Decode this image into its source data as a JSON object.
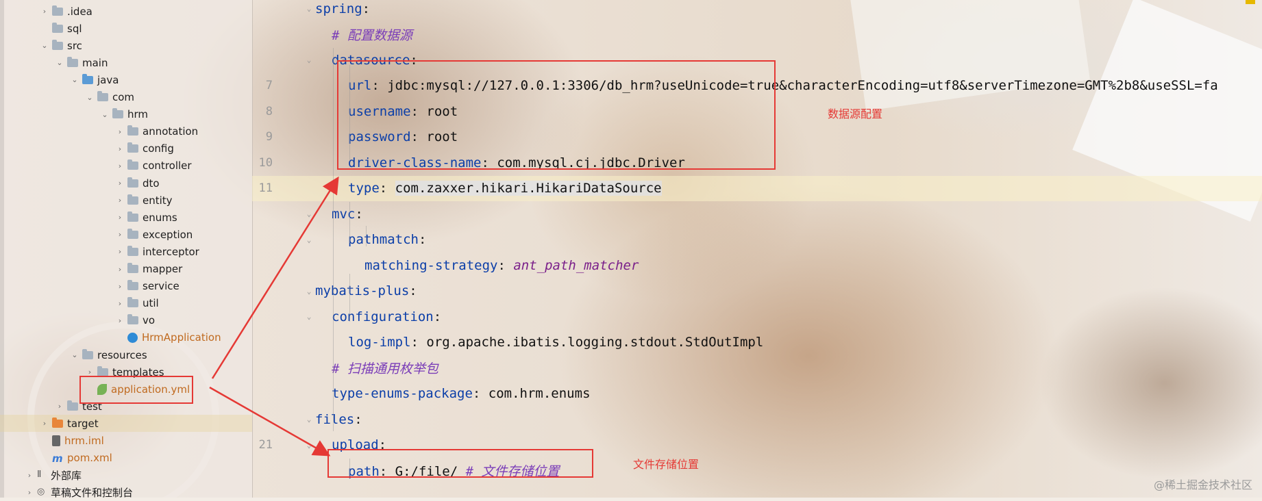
{
  "project_tree": [
    {
      "label": ".idea",
      "icon": "folder-icon",
      "expanded": false
    },
    {
      "label": "sql",
      "icon": "folder-icon"
    },
    {
      "label": "src",
      "icon": "folder-icon",
      "expanded": true
    },
    {
      "label": "main",
      "icon": "folder-icon",
      "expanded": true
    },
    {
      "label": "java",
      "icon": "source-folder-icon",
      "expanded": true
    },
    {
      "label": "com",
      "icon": "package-icon",
      "expanded": true
    },
    {
      "label": "hrm",
      "icon": "package-icon",
      "expanded": true
    },
    {
      "label": "annotation",
      "icon": "package-icon"
    },
    {
      "label": "config",
      "icon": "package-icon"
    },
    {
      "label": "controller",
      "icon": "package-icon"
    },
    {
      "label": "dto",
      "icon": "package-icon"
    },
    {
      "label": "entity",
      "icon": "package-icon"
    },
    {
      "label": "enums",
      "icon": "package-icon"
    },
    {
      "label": "exception",
      "icon": "package-icon"
    },
    {
      "label": "interceptor",
      "icon": "package-icon"
    },
    {
      "label": "mapper",
      "icon": "package-icon"
    },
    {
      "label": "service",
      "icon": "package-icon"
    },
    {
      "label": "util",
      "icon": "package-icon"
    },
    {
      "label": "vo",
      "icon": "package-icon"
    },
    {
      "label": "HrmApplication",
      "icon": "spring-class-icon"
    },
    {
      "label": "resources",
      "icon": "resources-folder-icon",
      "expanded": true
    },
    {
      "label": "templates",
      "icon": "folder-icon"
    },
    {
      "label": "application.yml",
      "icon": "yaml-file-icon"
    },
    {
      "label": "test",
      "icon": "folder-icon"
    },
    {
      "label": "target",
      "icon": "excluded-folder-icon"
    },
    {
      "label": "hrm.iml",
      "icon": "iml-file-icon"
    },
    {
      "label": "pom.xml",
      "icon": "maven-file-icon"
    },
    {
      "label": "外部库",
      "icon": "library-icon"
    },
    {
      "label": "草稿文件和控制台",
      "icon": "scratch-icon"
    }
  ],
  "editor": {
    "lines": [
      {
        "num": "",
        "key": "spring",
        "sep": ":",
        "value": "",
        "kind": "key"
      },
      {
        "num": "",
        "key": "",
        "sep": "",
        "value": "# 配置数据源",
        "kind": "comment"
      },
      {
        "num": "",
        "key": "datasource",
        "sep": ":",
        "value": "",
        "kind": "key"
      },
      {
        "num": "7",
        "key": "url",
        "sep": ": ",
        "value": "jdbc:mysql://127.0.0.1:3306/db_hrm?useUnicode=true&characterEncoding=utf8&serverTimezone=GMT%2b8&useSSL=fa",
        "kind": "pair"
      },
      {
        "num": "8",
        "key": "username",
        "sep": ": ",
        "value": "root",
        "kind": "pair"
      },
      {
        "num": "9",
        "key": "password",
        "sep": ": ",
        "value": "root",
        "kind": "pair"
      },
      {
        "num": "10",
        "key": "driver-class-name",
        "sep": ": ",
        "value": "com.mysql.cj.jdbc.Driver",
        "kind": "pair"
      },
      {
        "num": "11",
        "key": "type",
        "sep": ": ",
        "value": "com.zaxxer.hikari.HikariDataSource",
        "kind": "pair"
      },
      {
        "num": "",
        "key": "mvc",
        "sep": ":",
        "value": "",
        "kind": "key"
      },
      {
        "num": "",
        "key": "pathmatch",
        "sep": ":",
        "value": "",
        "kind": "key"
      },
      {
        "num": "",
        "key": "matching-strategy",
        "sep": ": ",
        "value": "ant_path_matcher",
        "kind": "pair-italic"
      },
      {
        "num": "",
        "key": "mybatis-plus",
        "sep": ":",
        "value": "",
        "kind": "key"
      },
      {
        "num": "",
        "key": "configuration",
        "sep": ":",
        "value": "",
        "kind": "key"
      },
      {
        "num": "",
        "key": "log-impl",
        "sep": ": ",
        "value": "org.apache.ibatis.logging.stdout.StdOutImpl",
        "kind": "pair"
      },
      {
        "num": "",
        "key": "",
        "sep": "",
        "value": "# 扫描通用枚举包",
        "kind": "comment"
      },
      {
        "num": "",
        "key": "type-enums-package",
        "sep": ": ",
        "value": "com.hrm.enums",
        "kind": "pair"
      },
      {
        "num": "",
        "key": "files",
        "sep": ":",
        "value": "",
        "kind": "key"
      },
      {
        "num": "21",
        "key": "upload",
        "sep": ":",
        "value": "",
        "kind": "key"
      },
      {
        "num": "",
        "key": "path",
        "sep": ": ",
        "value": "G:/file/",
        "comment": "# 文件存储位置",
        "kind": "pair-comment"
      }
    ]
  },
  "annotations": {
    "datasource_label": "数据源配置",
    "file_storage_label": "文件存储位置",
    "color": "#e53935"
  },
  "watermark": "@稀土掘金技术社区"
}
